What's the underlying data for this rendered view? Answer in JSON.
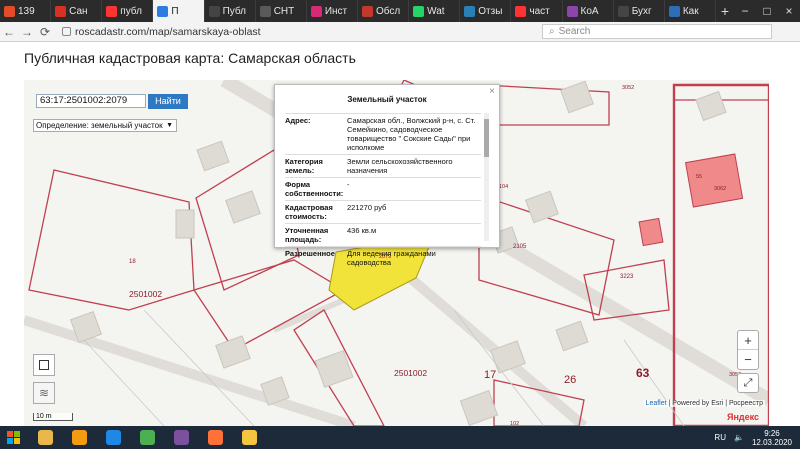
{
  "browser": {
    "tabs": [
      {
        "label": "139",
        "color": "#e34c26",
        "active": false
      },
      {
        "label": "Сан",
        "color": "#d93025",
        "active": false
      },
      {
        "label": "публ",
        "color": "#ff3333",
        "active": false
      },
      {
        "label": "П",
        "color": "#2b7de0",
        "active": true
      },
      {
        "label": "Публ",
        "color": "#444444",
        "active": false
      },
      {
        "label": "СНТ",
        "color": "#5a5a5a",
        "active": false
      },
      {
        "label": "Инст",
        "color": "#d62976",
        "active": false
      },
      {
        "label": "Обсл",
        "color": "#c0392b",
        "active": false
      },
      {
        "label": "Wat",
        "color": "#25d366",
        "active": false
      },
      {
        "label": "Отзы",
        "color": "#2980b9",
        "active": false
      },
      {
        "label": "част",
        "color": "#ff3333",
        "active": false
      },
      {
        "label": "КоА",
        "color": "#8e44ad",
        "active": false
      },
      {
        "label": "Бухг",
        "color": "#444444",
        "active": false
      },
      {
        "label": "Как",
        "color": "#2c6fb7",
        "active": false
      }
    ],
    "url": "roscadastr.com/map/samarskaya-oblast",
    "search_placeholder": "Search"
  },
  "page": {
    "title": "Публичная кадастровая карта: Самарская область"
  },
  "search_control": {
    "cadastral_number": "63:17:2501002:2079",
    "find_label": "Найти",
    "definition_label": "Определение:  земельный участок"
  },
  "popup": {
    "title": "Земельный участок",
    "rows": [
      {
        "label": "Адрес:",
        "value": "Самарская обл., Волжский р-н, с. Ст. Семейкино, садоводческое товарищество \" Сокские Сады\" при исполкоме"
      },
      {
        "label": "Категория земель:",
        "value": "Земли сельскохозяйственного назначения"
      },
      {
        "label": "Форма собственности:",
        "value": "-"
      },
      {
        "label": "Кадастровая стоимость:",
        "value": "221270 руб"
      },
      {
        "label": "Уточненная площадь:",
        "value": "436 кв.м"
      },
      {
        "label": "Разрешенное",
        "value": "Для ведения гражданами садоводства"
      }
    ]
  },
  "map": {
    "labels": [
      {
        "text": "18"
      },
      {
        "text": "2501002"
      },
      {
        "text": "2501002"
      },
      {
        "text": "17"
      },
      {
        "text": "26"
      },
      {
        "text": "63"
      },
      {
        "text": "63"
      },
      {
        "text": "3223"
      },
      {
        "text": "2105"
      },
      {
        "text": "3052"
      },
      {
        "text": "55"
      },
      {
        "text": "3062"
      },
      {
        "text": "3052"
      },
      {
        "text": "2079"
      },
      {
        "text": "104"
      },
      {
        "text": "102"
      }
    ],
    "scale_label": "10 m",
    "attribution_leaflet": "Leaflet",
    "attribution_rest": " | Powered by Esri | Росреестр",
    "yandex": "Яндекс"
  },
  "taskbar": {
    "lang": "RU",
    "time": "9:26",
    "date": "12.03.2020",
    "apps": [
      {
        "name": "explorer",
        "color": "#e8b84a"
      },
      {
        "name": "media",
        "color": "#f39c12"
      },
      {
        "name": "ie",
        "color": "#1e88e5"
      },
      {
        "name": "chrome",
        "color": "#4caf50"
      },
      {
        "name": "viber",
        "color": "#7b519d"
      },
      {
        "name": "firefox",
        "color": "#ff7139"
      },
      {
        "name": "app",
        "color": "#f5c542"
      }
    ]
  }
}
